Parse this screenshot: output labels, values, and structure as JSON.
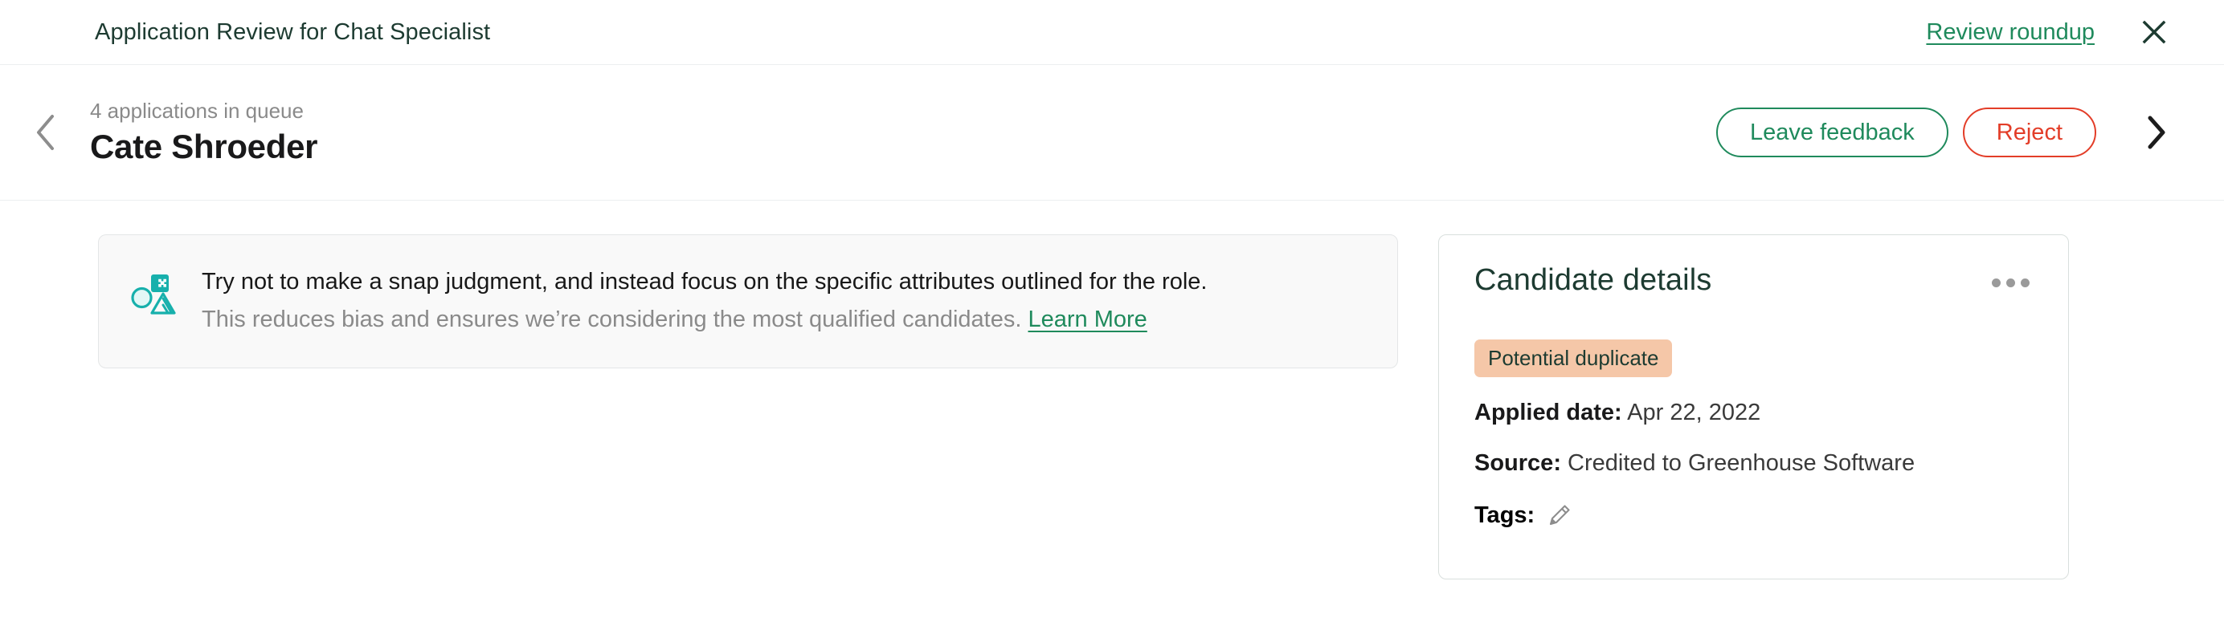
{
  "topbar": {
    "title": "Application Review for Chat Specialist",
    "review_roundup_label": "Review roundup",
    "close_icon": "close-icon"
  },
  "candidate_header": {
    "prev_icon": "chevron-left-icon",
    "next_icon": "chevron-right-icon",
    "queue_count": "4 applications in queue",
    "name": "Cate Shroeder",
    "leave_feedback_label": "Leave feedback",
    "reject_label": "Reject"
  },
  "banner": {
    "icon": "shapes-icon",
    "primary": "Try not to make a snap judgment, and instead focus on the specific attributes outlined for the role.",
    "secondary": "This reduces bias and ensures we’re considering the most qualified candidates.",
    "link_label": "Learn More"
  },
  "details": {
    "title": "Candidate details",
    "menu_icon": "more-options-icon",
    "badge": "Potential duplicate",
    "applied_date_label": "Applied date:",
    "applied_date_value": "Apr 22, 2022",
    "source_label": "Source:",
    "source_value": "Credited to Greenhouse Software",
    "tags_label": "Tags:",
    "tags_edit_icon": "pencil-icon"
  },
  "colors": {
    "brand_green": "#1f8a5c",
    "heading_green": "#1d3b31",
    "reject_red": "#e33d28",
    "badge_peach": "#f5c7a8",
    "teal_icon": "#17b0ac",
    "muted_gray": "#8a8a8a"
  }
}
